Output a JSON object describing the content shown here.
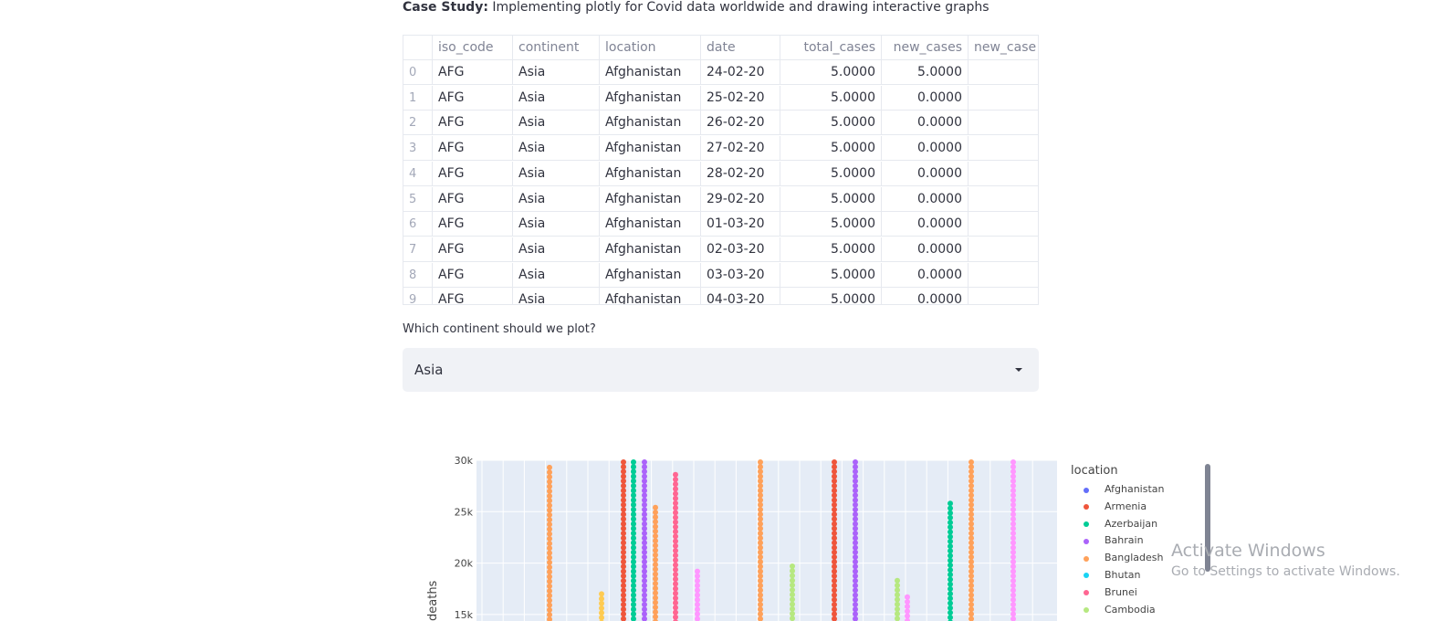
{
  "header": {
    "label": "Case Study:",
    "text": " Implementing plotly for Covid data worldwide and drawing interactive graphs"
  },
  "dataframe": {
    "columns": [
      "",
      "iso_code",
      "continent",
      "location",
      "date",
      "total_cases",
      "new_cases",
      "new_case"
    ],
    "rows": [
      [
        "0",
        "AFG",
        "Asia",
        "Afghanistan",
        "24-02-20",
        "5.0000",
        "5.0000",
        ""
      ],
      [
        "1",
        "AFG",
        "Asia",
        "Afghanistan",
        "25-02-20",
        "5.0000",
        "0.0000",
        ""
      ],
      [
        "2",
        "AFG",
        "Asia",
        "Afghanistan",
        "26-02-20",
        "5.0000",
        "0.0000",
        ""
      ],
      [
        "3",
        "AFG",
        "Asia",
        "Afghanistan",
        "27-02-20",
        "5.0000",
        "0.0000",
        ""
      ],
      [
        "4",
        "AFG",
        "Asia",
        "Afghanistan",
        "28-02-20",
        "5.0000",
        "0.0000",
        ""
      ],
      [
        "5",
        "AFG",
        "Asia",
        "Afghanistan",
        "29-02-20",
        "5.0000",
        "0.0000",
        ""
      ],
      [
        "6",
        "AFG",
        "Asia",
        "Afghanistan",
        "01-03-20",
        "5.0000",
        "0.0000",
        ""
      ],
      [
        "7",
        "AFG",
        "Asia",
        "Afghanistan",
        "02-03-20",
        "5.0000",
        "0.0000",
        ""
      ],
      [
        "8",
        "AFG",
        "Asia",
        "Afghanistan",
        "03-03-20",
        "5.0000",
        "0.0000",
        ""
      ],
      [
        "9",
        "AFG",
        "Asia",
        "Afghanistan",
        "04-03-20",
        "5.0000",
        "0.0000",
        ""
      ]
    ]
  },
  "select": {
    "label": "Which continent should we plot?",
    "value": "Asia"
  },
  "chart_data": {
    "type": "scatter",
    "xlabel": "",
    "ylabel": "deaths",
    "yticks": [
      "15k",
      "20k",
      "25k",
      "30k"
    ],
    "ylim": [
      15000,
      30000
    ],
    "legend_title": "location",
    "legend_position": "right",
    "grid": true,
    "series": [
      {
        "name": "Afghanistan",
        "color": "#636efa"
      },
      {
        "name": "Armenia",
        "color": "#ef553b"
      },
      {
        "name": "Azerbaijan",
        "color": "#00cc96"
      },
      {
        "name": "Bahrain",
        "color": "#ab63fa"
      },
      {
        "name": "Bangladesh",
        "color": "#ffa15a"
      },
      {
        "name": "Bhutan",
        "color": "#19d3f3"
      },
      {
        "name": "Brunei",
        "color": "#ff6692"
      },
      {
        "name": "Cambodia",
        "color": "#b6e880"
      }
    ],
    "visible_columns": [
      {
        "color": "#ffa15a",
        "top": 29300
      },
      {
        "color": "#fecb52",
        "top": 17000
      },
      {
        "color": "#ef553b",
        "top": 30000
      },
      {
        "color": "#00cc96",
        "top": 30000
      },
      {
        "color": "#ab63fa",
        "top": 30000
      },
      {
        "color": "#ffa15a",
        "top": 25400
      },
      {
        "color": "#ff6692",
        "top": 28600
      },
      {
        "color": "#ff97ff",
        "top": 19200
      },
      {
        "color": "#ffa15a",
        "top": 30000
      },
      {
        "color": "#b6e880",
        "top": 19700
      },
      {
        "color": "#ef553b",
        "top": 30000
      },
      {
        "color": "#ab63fa",
        "top": 30000
      },
      {
        "color": "#b6e880",
        "top": 18300
      },
      {
        "color": "#ff97ff",
        "top": 16700
      },
      {
        "color": "#00cc96",
        "top": 25800
      },
      {
        "color": "#ffa15a",
        "top": 30000
      },
      {
        "color": "#ff97ff",
        "top": 30000
      }
    ]
  },
  "watermark": {
    "line1": "Activate Windows",
    "line2": "Go to Settings to activate Windows."
  }
}
